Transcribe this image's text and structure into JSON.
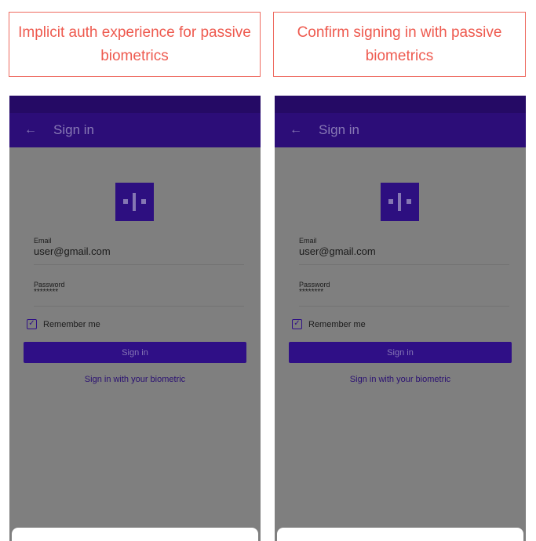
{
  "captions": [
    "Implicit auth experience for passive biometrics",
    "Confirm signing in with passive biometrics"
  ],
  "screen": {
    "back_icon": "arrow-left-icon",
    "title": "Sign in",
    "logo_icon": "app-logo-icon",
    "email_label": "Email",
    "email_value": "user@gmail.com",
    "password_label": "Password",
    "password_value": "********",
    "remember_label": "Remember me",
    "remember_checked": true,
    "signin_button": "Sign in",
    "biometric_link": "Sign in with your biometric"
  },
  "colors": {
    "caption_text": "#ee5a4f",
    "caption_border": "#ee6a60",
    "app_bar": "#2c0d78",
    "status_bar": "#250a65",
    "scrim": "#7f7f7f",
    "primary": "#2f0f86"
  }
}
